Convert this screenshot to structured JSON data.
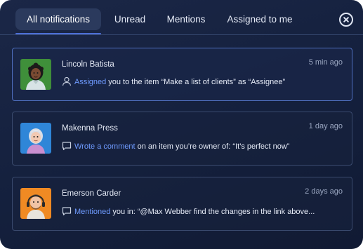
{
  "tabs": [
    {
      "label": "All notifications",
      "active": true
    },
    {
      "label": "Unread",
      "active": false
    },
    {
      "label": "Mentions",
      "active": false
    },
    {
      "label": "Assigned to me",
      "active": false
    }
  ],
  "close_icon": "close-circle-icon",
  "notifications": [
    {
      "name": "Lincoln Batista",
      "time": "5 min ago",
      "icon": "user-icon",
      "action": "Assigned",
      "text": "you to the item “Make a list of clients” as “Assignee”",
      "avatar_bg": "#3f8f3a",
      "highlighted": true
    },
    {
      "name": "Makenna Press",
      "time": "1 day ago",
      "icon": "comment-icon",
      "action": "Wrote a comment",
      "text": "on an item you’re owner of: “It’s perfect now”",
      "avatar_bg": "#2f86d8",
      "highlighted": false
    },
    {
      "name": "Emerson Carder",
      "time": "2 days ago",
      "icon": "comment-icon",
      "action": "Mentioned",
      "text": "you in: “@Max Webber find the changes in the link above...",
      "avatar_bg": "#f08a23",
      "highlighted": false
    }
  ],
  "colors": {
    "panel_bg": "#16213f",
    "accent": "#6f9bff",
    "tab_active_bg": "#2b3a5d",
    "card_border": "#3a4a6e",
    "card_highlight_border": "#4f6fbf"
  }
}
